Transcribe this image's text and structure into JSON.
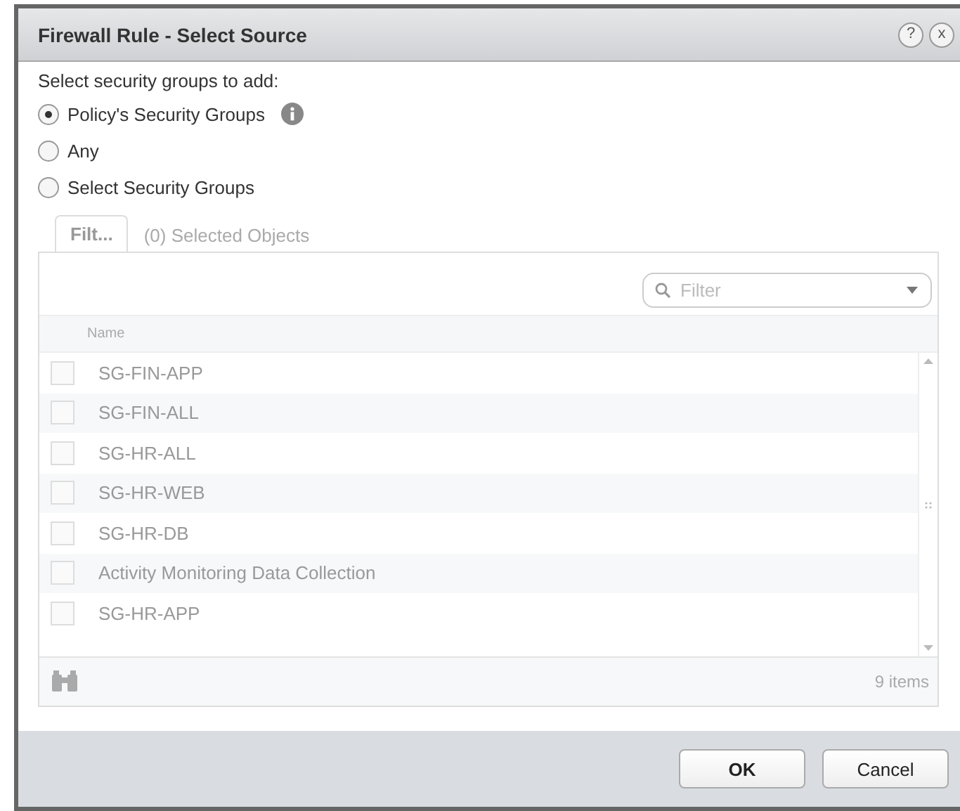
{
  "dialog": {
    "title": "Firewall Rule - Select Source",
    "help": "?",
    "close": "x"
  },
  "prompt": "Select security groups to add:",
  "options": [
    {
      "label": "Policy's Security Groups",
      "selected": true,
      "kind": "info"
    },
    {
      "label": "Any",
      "selected": false,
      "kind": "plain"
    },
    {
      "label": "Select Security Groups",
      "selected": false,
      "kind": "plain"
    }
  ],
  "tabs": [
    {
      "label": "Filt...",
      "selected": true
    },
    {
      "label": "(0) Selected Objects",
      "selected": false
    }
  ],
  "filter": {
    "placeholder": "Filter"
  },
  "table": {
    "disabled": true,
    "columns": [
      "Name"
    ],
    "rows": [
      {
        "name": "SG-FIN-APP",
        "checked": false
      },
      {
        "name": "SG-FIN-ALL",
        "checked": false
      },
      {
        "name": "SG-HR-ALL",
        "checked": false
      },
      {
        "name": "SG-HR-WEB",
        "checked": false
      },
      {
        "name": "SG-HR-DB",
        "checked": false
      },
      {
        "name": "Activity Monitoring Data Collection",
        "checked": false
      },
      {
        "name": "SG-HR-APP",
        "checked": false
      }
    ],
    "count": "9 items"
  },
  "buttons": [
    "OK",
    "Cancel"
  ]
}
